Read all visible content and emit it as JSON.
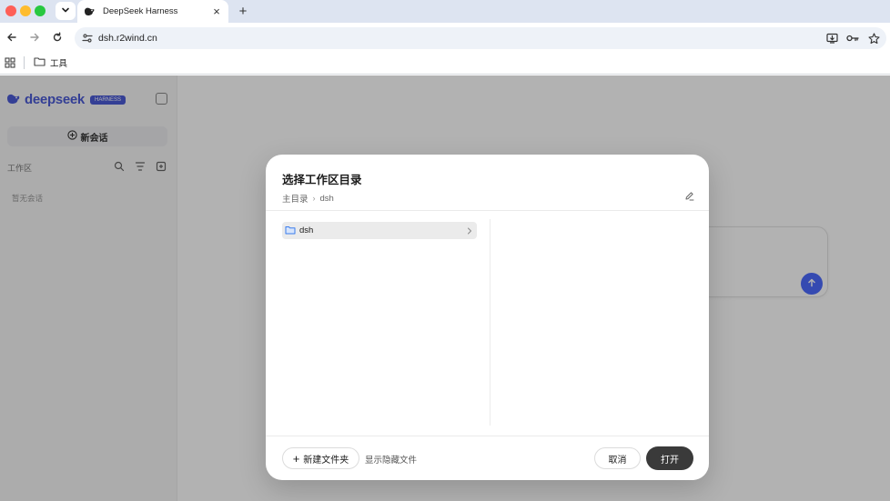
{
  "browser": {
    "tab_title": "DeepSeek Harness",
    "tab_close": "×",
    "new_tab": "+",
    "url": "dsh.r2wind.cn",
    "bookmark_folder_label": "工具"
  },
  "sidebar": {
    "brand_name": "deepseek",
    "brand_badge": "HARNESS",
    "new_chat_label": "新会话",
    "workspace_title": "工作区",
    "empty_note": "暂无会话"
  },
  "dialog": {
    "title": "选择工作区目录",
    "breadcrumb": [
      "主目录",
      "dsh"
    ],
    "breadcrumb_separator": "›",
    "directories": [
      {
        "name": "dsh",
        "selected": true
      }
    ],
    "new_folder_label": "新建文件夹",
    "new_folder_plus": "+",
    "show_hidden_label": "显示隐藏文件",
    "cancel_label": "取消",
    "open_label": "打开"
  },
  "colors": {
    "brand": "#4b5bd6",
    "send_button": "#4d6bfe",
    "primary_button": "#3a3a3a",
    "folder_icon": "#3b7ded",
    "tab_strip": "#dde4f1"
  },
  "icons": {
    "tab_search": "chevron-down-icon",
    "favicon": "deepseek-whale-icon",
    "back": "arrow-left-icon",
    "forward": "arrow-right-icon",
    "reload": "reload-icon",
    "site_info": "tune-icon",
    "install_app": "install-icon",
    "password": "key-icon",
    "bookmark_star": "star-icon",
    "apps": "grid-icon",
    "folder": "folder-icon",
    "edit_path": "pencil-icon",
    "send": "arrow-up-icon"
  }
}
